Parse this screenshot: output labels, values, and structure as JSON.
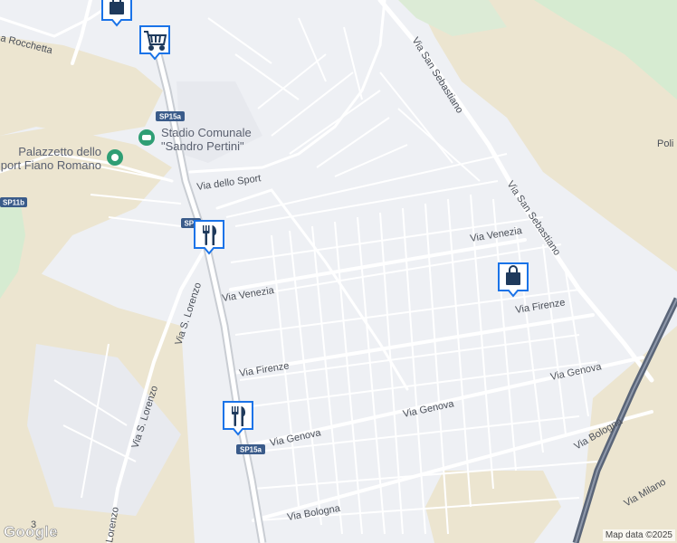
{
  "map": {
    "streets": {
      "rocchetta": "a Rocchetta",
      "dello_sport": "Via dello Sport",
      "venezia_1": "Via Venezia",
      "venezia_2": "Via Venezia",
      "firenze_1": "Via Firenze",
      "firenze_2": "Via Firenze",
      "genova_1": "Via Genova",
      "genova_2": "Via Genova",
      "genova_3": "Via Genova",
      "bologna_1": "Via Bologna",
      "bologna_2": "Via Bologna",
      "san_sebastiano_1": "Via San Sebastiano",
      "san_sebastiano_2": "Via San Sebastiano",
      "s_lorenzo_1": "Via S. Lorenzo",
      "s_lorenzo_2": "Via S. Lorenzo",
      "lorenzo_partial": "Lorenzo",
      "milano": "Via Milano",
      "poli_partial": "Poli",
      "corner_partial": "3"
    },
    "road_shields": {
      "sp15a_top": "SP15a",
      "sp11b": "SP11b",
      "sp_mid": "SP1",
      "sp15a_bottom": "SP15a"
    },
    "pois": {
      "stadio_line1": "Stadio Comunale",
      "stadio_line2": "\"Sandro Pertini\"",
      "palazzetto_line1": "Palazzetto dello",
      "palazzetto_line2": "Sport Fiano Romano"
    },
    "markers": [
      {
        "name": "shopping-bag-marker",
        "icon": "shopping-bag-icon"
      },
      {
        "name": "shopping-cart-marker",
        "icon": "shopping-cart-icon"
      },
      {
        "name": "restaurant-marker",
        "icon": "fork-knife-icon"
      },
      {
        "name": "shopping-bag-marker",
        "icon": "shopping-bag-icon"
      },
      {
        "name": "restaurant-marker",
        "icon": "fork-knife-icon"
      }
    ],
    "attribution": "Map data ©2025",
    "logo": "Google"
  },
  "colors": {
    "background": "#eef0f4",
    "road": "#ffffff",
    "highway": "#c9cdd3",
    "railway": "#5a6578",
    "green": "#d6ebd1",
    "sand": "#ece5d0",
    "marker_border": "#1a73e8",
    "marker_icon": "#1f3a5c",
    "shield": "#3a5b8a"
  }
}
